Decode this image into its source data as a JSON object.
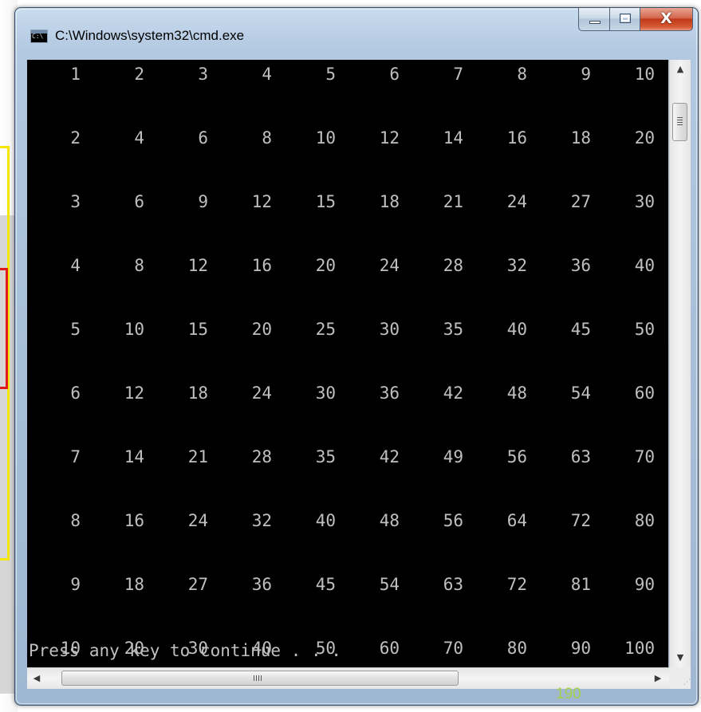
{
  "window": {
    "title": "C:\\Windows\\system32\\cmd.exe",
    "icon_text": "C:\\",
    "buttons": {
      "minimize_icon": "minimize-icon",
      "maximize_icon": "maximize-icon",
      "close_glyph": "X"
    }
  },
  "console": {
    "rows": [
      [
        "1",
        "2",
        "3",
        "4",
        "5",
        "6",
        "7",
        "8",
        "9",
        "10"
      ],
      [
        "2",
        "4",
        "6",
        "8",
        "10",
        "12",
        "14",
        "16",
        "18",
        "20"
      ],
      [
        "3",
        "6",
        "9",
        "12",
        "15",
        "18",
        "21",
        "24",
        "27",
        "30"
      ],
      [
        "4",
        "8",
        "12",
        "16",
        "20",
        "24",
        "28",
        "32",
        "36",
        "40"
      ],
      [
        "5",
        "10",
        "15",
        "20",
        "25",
        "30",
        "35",
        "40",
        "45",
        "50"
      ],
      [
        "6",
        "12",
        "18",
        "24",
        "30",
        "36",
        "42",
        "48",
        "54",
        "60"
      ],
      [
        "7",
        "14",
        "21",
        "28",
        "35",
        "42",
        "49",
        "56",
        "63",
        "70"
      ],
      [
        "8",
        "16",
        "24",
        "32",
        "40",
        "48",
        "56",
        "64",
        "72",
        "80"
      ],
      [
        "9",
        "18",
        "27",
        "36",
        "45",
        "54",
        "63",
        "72",
        "81",
        "90"
      ],
      [
        "10",
        "20",
        "30",
        "40",
        "50",
        "60",
        "70",
        "80",
        "90",
        "100"
      ]
    ],
    "prompt": "Press any key to continue . . ."
  },
  "scrollbars": {
    "up_arrow": "▲",
    "down_arrow": "▼",
    "left_arrow": "◀",
    "right_arrow": "▶"
  },
  "overlay_number": "190",
  "colors": {
    "console_bg": "#000000",
    "console_fg": "#c0c0c0",
    "close_button": "#c1391c",
    "overlay_number": "#a6d24a",
    "highlight_yellow": "#f5e600",
    "highlight_red": "#e01919"
  }
}
